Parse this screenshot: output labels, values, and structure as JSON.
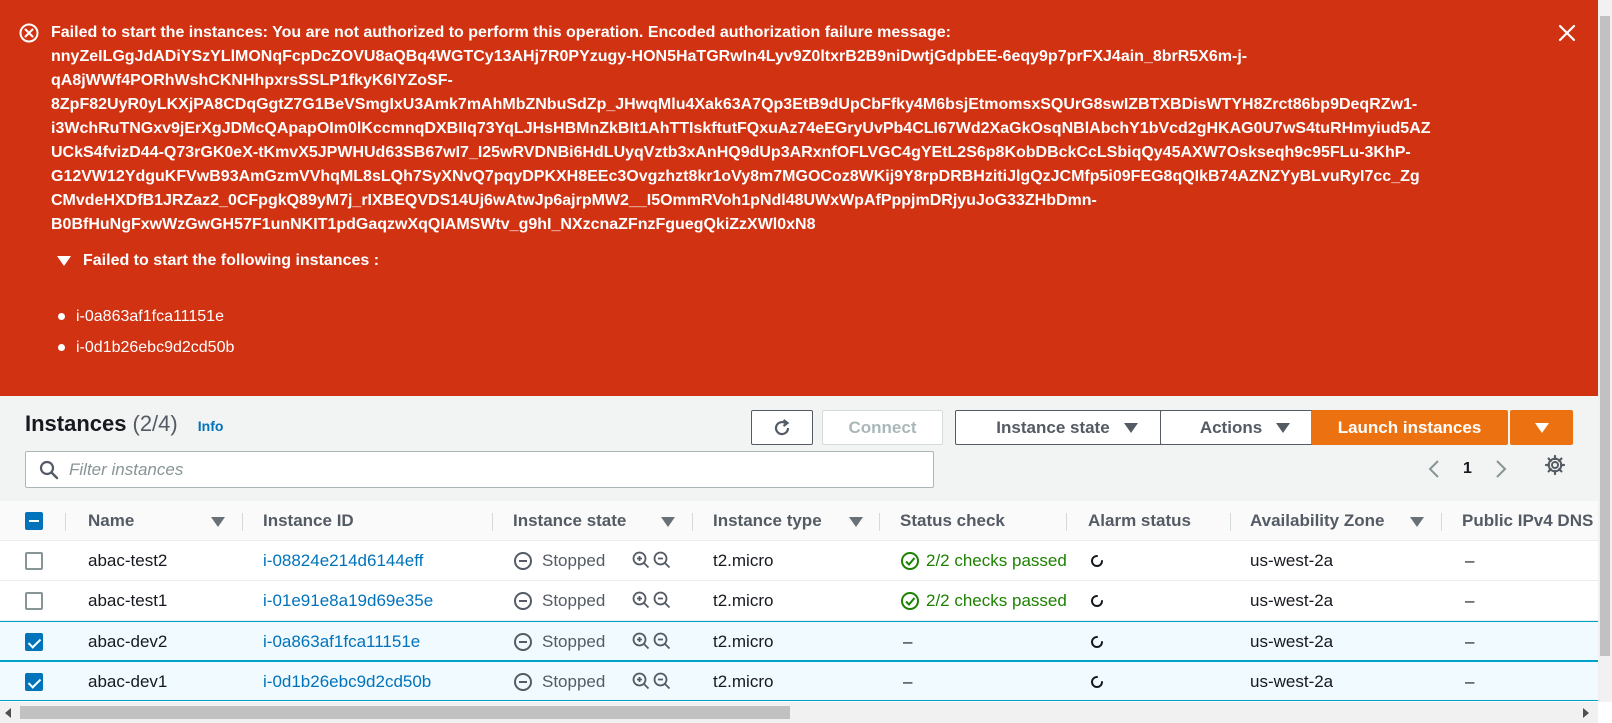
{
  "flash": {
    "type": "error",
    "title": "Failed to start the instances: You are not authorized to perform this operation. Encoded authorization failure message:",
    "encoded_message_lines": [
      "nnyZeILGgJdADiYSzYLlMONqFcpDcZOVU8aQBq4WGTCy13AHj7R0PYzugy-HON5HaTGRwIn4Lyv9Z0ltxrB2B9niDwtjGdpbEE-6eqy9p7prFXJ4ain_8brR5X6m-j-",
      "qA8jWWf4PORhWshCKNHhpxrsSSLP1fkyK6lYZoSF-",
      "8ZpF82UyR0yLKXjPA8CDqGgtZ7G1BeVSmgIxU3Amk7mAhMbZNbuSdZp_JHwqMlu4Xak63A7Qp3EtB9dUpCbFfky4M6bsjEtmomsxSQUrG8swIZBTXBDisWTYH8Zrct86bp9DeqRZw1-",
      "i3WchRuTNGxv9jErXgJDMcQApapOIm0lKccmnqDXBIIq73YqLJHsHBMnZkBIt1AhTTIskftutFQxuAz74eEGryUvPb4CLI67Wd2XaGkOsqNBlAbchY1bVcd2gHKAG0U7wS4tuRHmyiud5AZ",
      "UCkS4fvizD44-Q73rGK0eX-tKmvX5JPWHUd63SB67wI7_I25wRVDNBi6HdLUyqVztb3xAnHQ9dUp3ARxnfOFLVGC4gYEtL2S6p8KobDBckCcLSbiqQy45AXW7Oskseqh9c95FLu-3KhP-",
      "G12VW12YdguKFVwB93AmGzmVVhqML8sLQh7SyXNvQ7pqyDPKXH8EEc3Ovgzhzt8kr1oVy8m7MGOCoz8WKij9Y8rpDRBHzitiJlgQzJCMfp5i09FEG8qQIkB74AZNZYyBLvuRyI7cc_Zg",
      "CMvdeHXDfB1JRZaz2_0CFpgkQ89yM7j_rIXBEQVDS14Uj6wAtwJp6ajrpMW2__I5OmmRVoh1pNdl48UWxWpAfPppjmDRjyuJoG33ZHbDmn-",
      "B0BfHuNgFxwWzGwGH57F1unNKIT1pdGaqzwXqQIAMSWtv_g9hI_NXzcnaZFnzFguegQkiZzXWl0xN8"
    ],
    "details_label": "Failed to start the following instances :",
    "failed_instances": [
      "i-0a863af1fca11151e",
      "i-0d1b26ebc9d2cd50b"
    ]
  },
  "header": {
    "title": "Instances",
    "count": "(2/4)",
    "info_link": "Info",
    "connect_label": "Connect",
    "instance_state_label": "Instance state",
    "actions_label": "Actions",
    "launch_label": "Launch instances"
  },
  "search": {
    "placeholder": "Filter instances",
    "value": ""
  },
  "pagination": {
    "current_page": "1"
  },
  "table": {
    "columns": [
      "Name",
      "Instance ID",
      "Instance state",
      "Instance type",
      "Status check",
      "Alarm status",
      "Availability Zone",
      "Public IPv4 DNS"
    ],
    "rows": [
      {
        "selected": false,
        "name": "abac-test2",
        "instance_id": "i-08824e214d6144eff",
        "state": "Stopped",
        "type": "t2.micro",
        "status_check": "2/2 checks passed",
        "status_ok": true,
        "az": "us-west-2a",
        "dns": "–"
      },
      {
        "selected": false,
        "name": "abac-test1",
        "instance_id": "i-01e91e8a19d69e35e",
        "state": "Stopped",
        "type": "t2.micro",
        "status_check": "2/2 checks passed",
        "status_ok": true,
        "az": "us-west-2a",
        "dns": "–"
      },
      {
        "selected": true,
        "name": "abac-dev2",
        "instance_id": "i-0a863af1fca11151e",
        "state": "Stopped",
        "type": "t2.micro",
        "status_check": "–",
        "status_ok": false,
        "az": "us-west-2a",
        "dns": "–"
      },
      {
        "selected": true,
        "name": "abac-dev1",
        "instance_id": "i-0d1b26ebc9d2cd50b",
        "state": "Stopped",
        "type": "t2.micro",
        "status_check": "–",
        "status_ok": false,
        "az": "us-west-2a",
        "dns": "–"
      }
    ]
  },
  "colors": {
    "error_bg": "#d13212",
    "primary": "#ec7211",
    "link": "#0073bb",
    "success": "#1d8102"
  }
}
